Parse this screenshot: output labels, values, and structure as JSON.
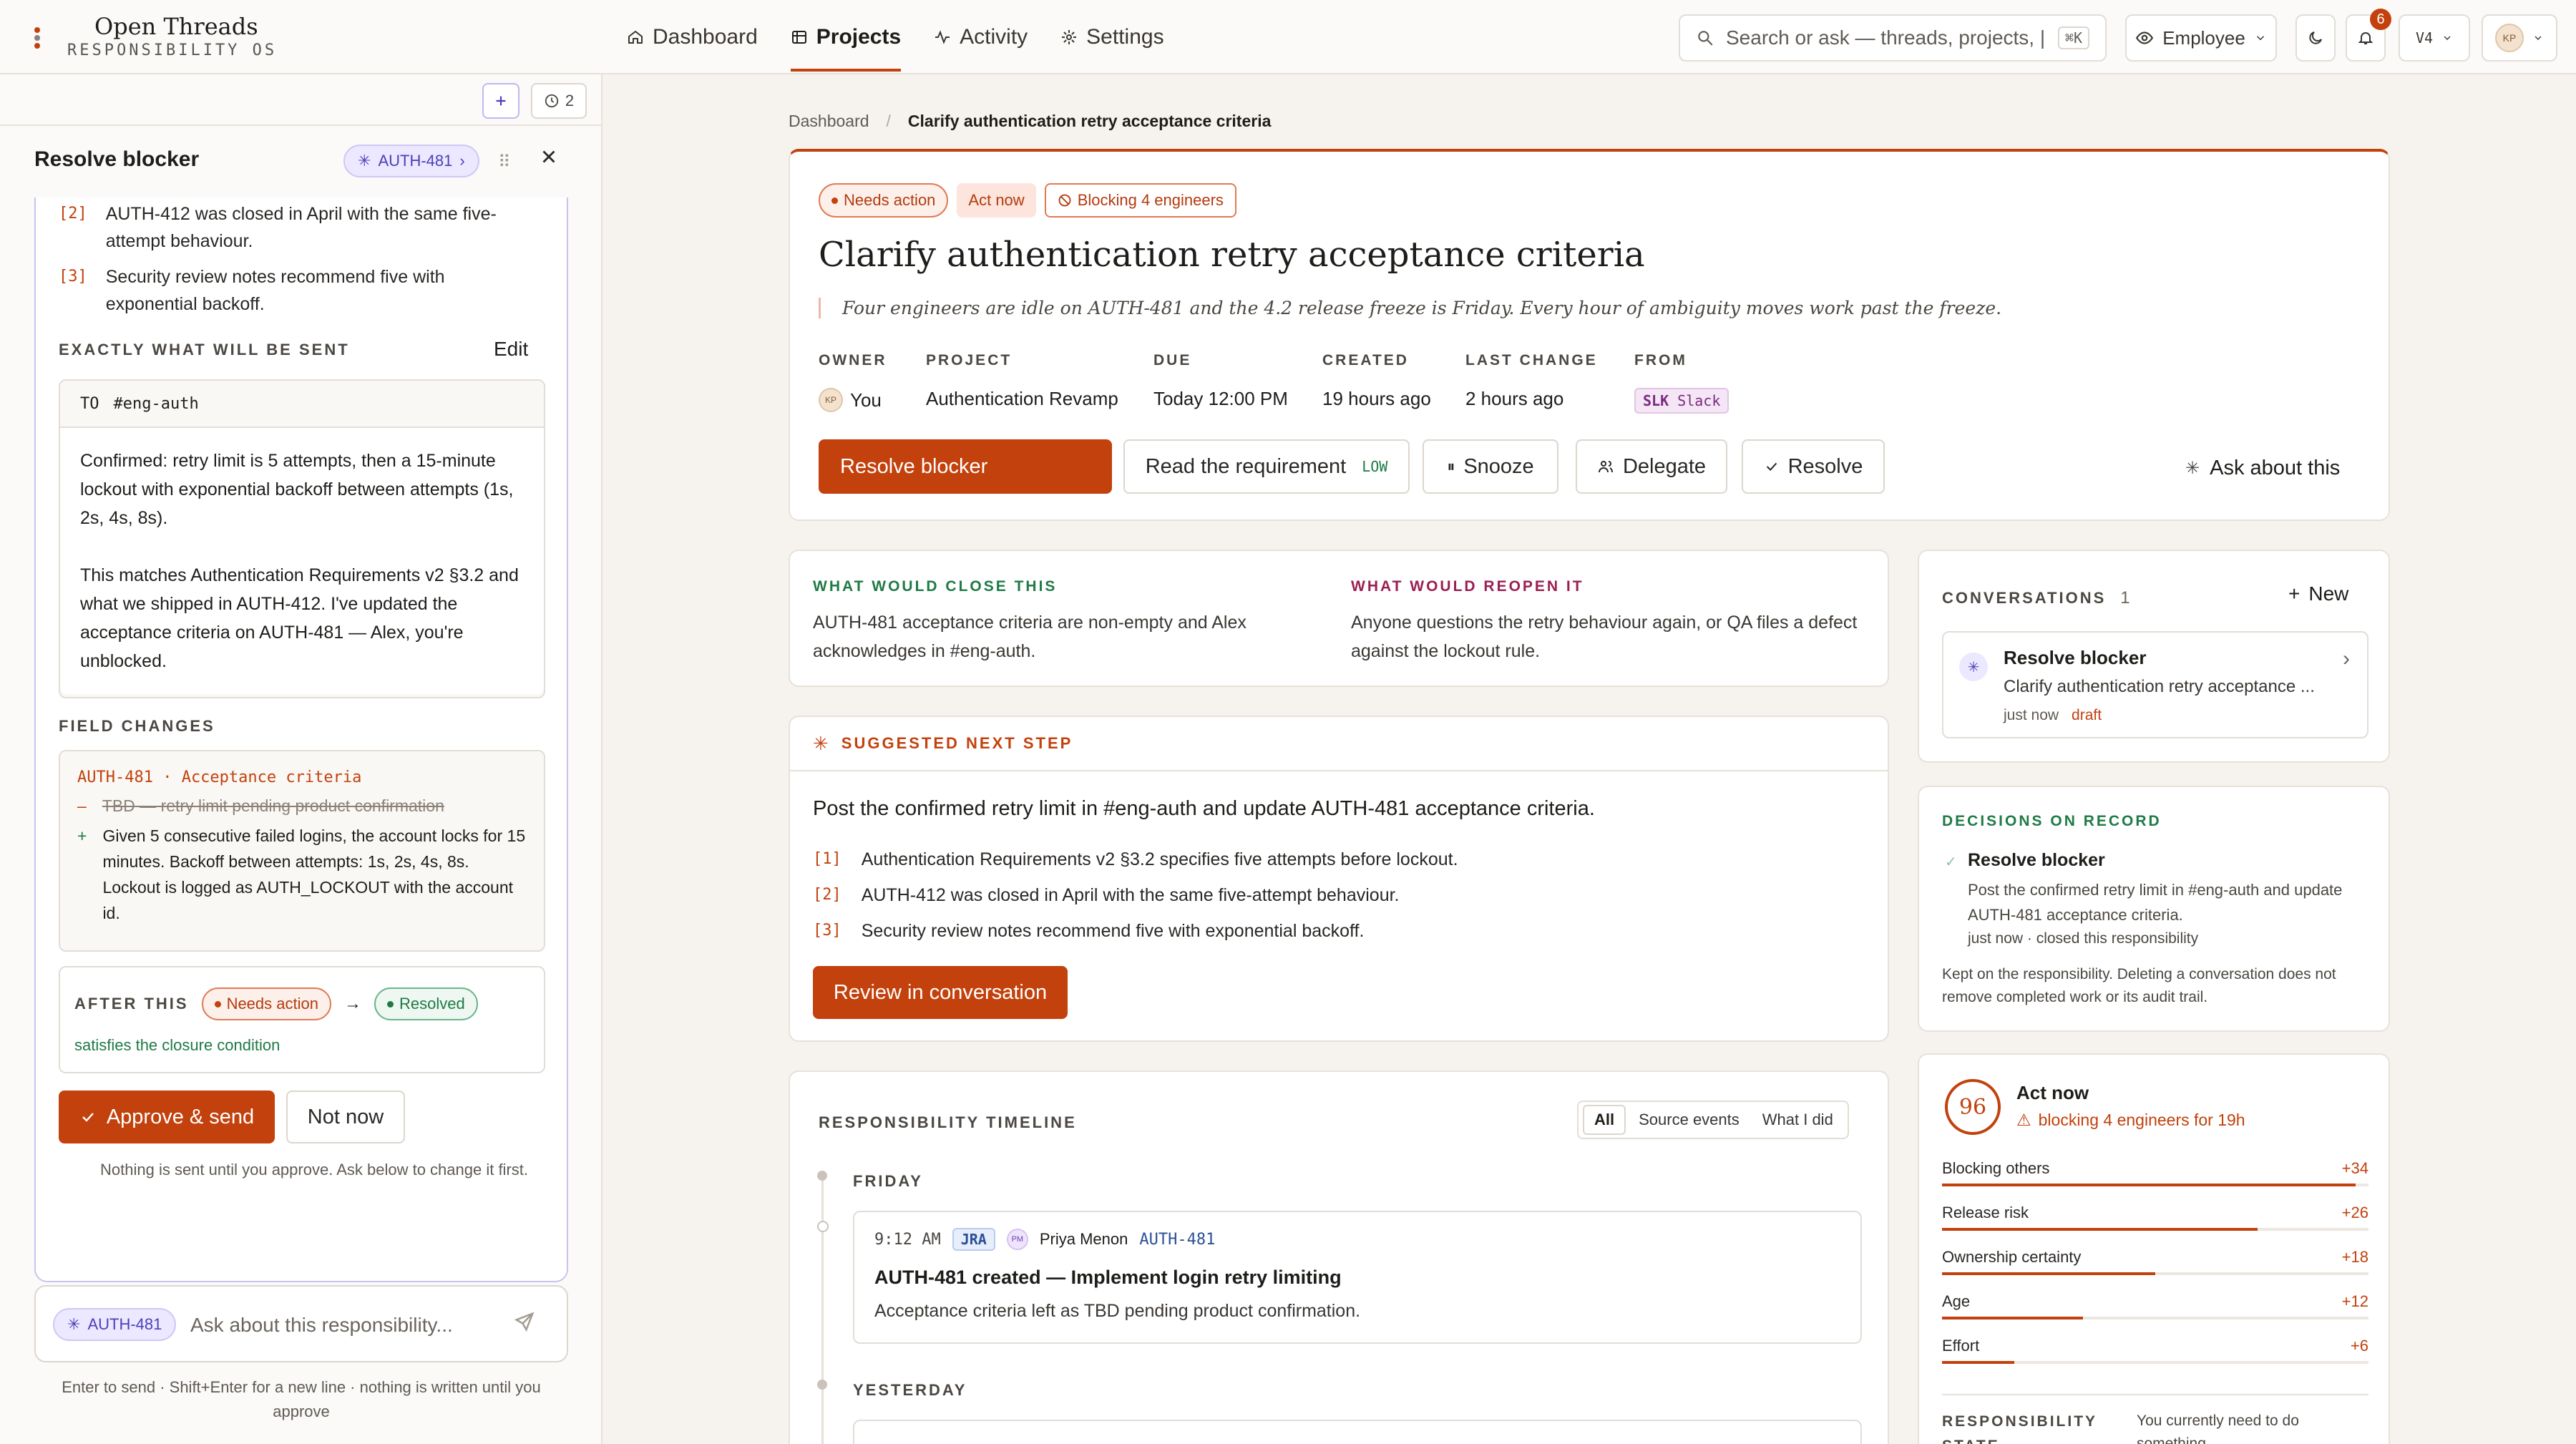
{
  "app": {
    "name": "Open Threads",
    "subtitle": "RESPONSIBILITY OS",
    "nav": [
      {
        "label": "Dashboard",
        "icon": "home-icon"
      },
      {
        "label": "Projects",
        "icon": "projects-icon",
        "active": true
      },
      {
        "label": "Activity",
        "icon": "activity-icon"
      },
      {
        "label": "Settings",
        "icon": "settings-icon"
      }
    ],
    "search_placeholder": "Search or ask — threads, projects, |",
    "search_shortcut": "⌘K",
    "role_label": "Employee",
    "notif_count": "6",
    "version_label": "V4",
    "avatar_initials": "KP"
  },
  "left": {
    "history_count": "2",
    "title": "Resolve blocker",
    "ticket_chip": "AUTH-481",
    "citations_top": [
      {
        "n": "[2]",
        "text": "AUTH-412 was closed in April with the same five-attempt behaviour."
      },
      {
        "n": "[3]",
        "text": "Security review notes recommend five with exponential backoff."
      }
    ],
    "send_header": "EXACTLY WHAT WILL BE SENT",
    "edit_label": "Edit",
    "to_label": "TO",
    "to_value": "#eng-auth",
    "message_p1": "Confirmed: retry limit is 5 attempts, then a 15-minute lockout with exponential backoff between attempts (1s, 2s, 4s, 8s).",
    "message_p2": "This matches Authentication Requirements v2 §3.2 and what we shipped in AUTH-412. I've updated the acceptance criteria on AUTH-481 — Alex, you're unblocked.",
    "field_changes_header": "FIELD CHANGES",
    "field_name": "AUTH-481 · Acceptance criteria",
    "removed_text": "TBD — retry limit pending product confirmation",
    "added_text": "Given 5 consecutive failed logins, the account locks for 15 minutes. Backoff between attempts: 1s, 2s, 4s, 8s. Lockout is logged as AUTH_LOCKOUT with the account id.",
    "after_label": "AFTER THIS",
    "from_state": "Needs action",
    "to_state": "Resolved",
    "closure_note": "satisfies the closure condition",
    "approve_label": "Approve & send",
    "not_now_label": "Not now",
    "approve_note": "Nothing is sent until you approve. Ask below to change it first.",
    "composer_chip": "AUTH-481",
    "composer_placeholder": "Ask about this responsibility...",
    "composer_hint": "Enter to send · Shift+Enter for a new line · nothing is written until you approve"
  },
  "breadcrumb": {
    "root": "Dashboard",
    "current": "Clarify authentication retry acceptance criteria"
  },
  "hero": {
    "badges": {
      "needs": "Needs action",
      "act": "Act now",
      "blocking": "Blocking 4 engineers"
    },
    "title": "Clarify authentication retry acceptance criteria",
    "quote": "Four engineers are idle on AUTH-481 and the 4.2 release freeze is Friday. Every hour of ambiguity moves work past the freeze.",
    "meta": [
      {
        "label": "OWNER",
        "value": "You"
      },
      {
        "label": "PROJECT",
        "value": "Authentication Revamp"
      },
      {
        "label": "DUE",
        "value": "Today 12:00 PM"
      },
      {
        "label": "CREATED",
        "value": "19 hours ago"
      },
      {
        "label": "LAST CHANGE",
        "value": "2 hours ago"
      },
      {
        "label": "FROM",
        "value": "Slack",
        "chip": "SLK"
      }
    ],
    "actions": {
      "primary": "Resolve blocker",
      "read": "Read the requirement",
      "read_tag": "LOW",
      "snooze": "Snooze",
      "delegate": "Delegate",
      "resolve": "Resolve",
      "ask": "Ask about this"
    }
  },
  "closure": {
    "close_header": "WHAT WOULD CLOSE THIS",
    "close_text": "AUTH-481 acceptance criteria are non-empty and Alex acknowledges in #eng-auth.",
    "reopen_header": "WHAT WOULD REOPEN IT",
    "reopen_text": "Anyone questions the retry behaviour again, or QA files a defect against the lockout rule."
  },
  "suggested": {
    "header": "SUGGESTED NEXT STEP",
    "text": "Post the confirmed retry limit in #eng-auth and update AUTH-481 acceptance criteria.",
    "citations": [
      {
        "n": "[1]",
        "text": "Authentication Requirements v2 §3.2 specifies five attempts before lockout."
      },
      {
        "n": "[2]",
        "text": "AUTH-412 was closed in April with the same five-attempt behaviour."
      },
      {
        "n": "[3]",
        "text": "Security review notes recommend five with exponential backoff."
      }
    ],
    "button": "Review in conversation"
  },
  "timeline": {
    "header": "RESPONSIBILITY TIMELINE",
    "filters": [
      "All",
      "Source events",
      "What I did"
    ],
    "day1": "FRIDAY",
    "event": {
      "time": "9:12 AM",
      "source": "JRA",
      "person_initials": "PM",
      "person": "Priya Menon",
      "ticket": "AUTH-481",
      "title": "AUTH-481 created — Implement login retry limiting",
      "desc": "Acceptance criteria left as TBD pending product confirmation."
    },
    "day2": "YESTERDAY"
  },
  "conversations": {
    "header": "CONVERSATIONS",
    "count": "1",
    "new_label": "New",
    "item_title": "Resolve blocker",
    "item_sub": "Clarify authentication retry acceptance ...",
    "item_time": "just now",
    "item_state": "draft"
  },
  "decisions": {
    "header": "DECISIONS ON RECORD",
    "title": "Resolve blocker",
    "text": "Post the confirmed retry limit in #eng-auth and update AUTH-481 acceptance criteria.",
    "meta": "just now · closed this responsibility",
    "note": "Kept on the responsibility. Deleting a conversation does not remove completed work or its audit trail."
  },
  "score": {
    "value": "96",
    "label": "Act now",
    "reason": "blocking 4 engineers for 19h",
    "factors": [
      {
        "label": "Blocking others",
        "delta": "+34",
        "level": 0.97
      },
      {
        "label": "Release risk",
        "delta": "+26",
        "level": 0.74
      },
      {
        "label": "Ownership certainty",
        "delta": "+18",
        "level": 0.5
      },
      {
        "label": "Age",
        "delta": "+12",
        "level": 0.33
      },
      {
        "label": "Effort",
        "delta": "+6",
        "level": 0.17
      }
    ],
    "state_label": "RESPONSIBILITY STATE",
    "state_text": "You currently need to do something"
  },
  "colors": {
    "accent": "#c2410c",
    "success": "#1f7a46",
    "violet": "#4c3fb8"
  }
}
